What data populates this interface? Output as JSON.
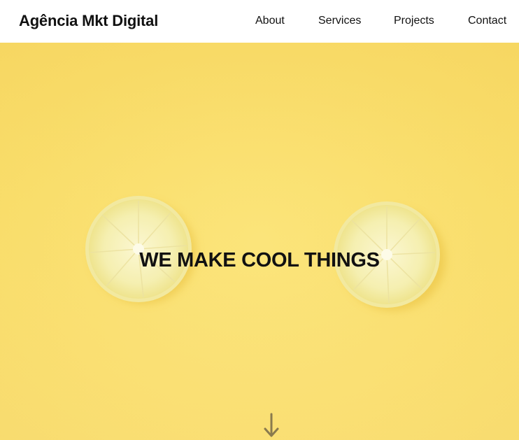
{
  "navbar": {
    "brand": "Agência Mkt Digital",
    "links": [
      {
        "label": "About"
      },
      {
        "label": "Services"
      },
      {
        "label": "Projects"
      },
      {
        "label": "Contact"
      }
    ]
  },
  "hero": {
    "title": "WE MAKE COOL THINGS",
    "background_color": "#fae06f",
    "scroll_icon": "arrow-down-icon"
  },
  "colors": {
    "text": "#111111",
    "nav_bg": "#ffffff",
    "lemon_flesh": "#f7f2b8",
    "lemon_rind": "#f3ec9c",
    "arrow": "#8a7a4e"
  }
}
